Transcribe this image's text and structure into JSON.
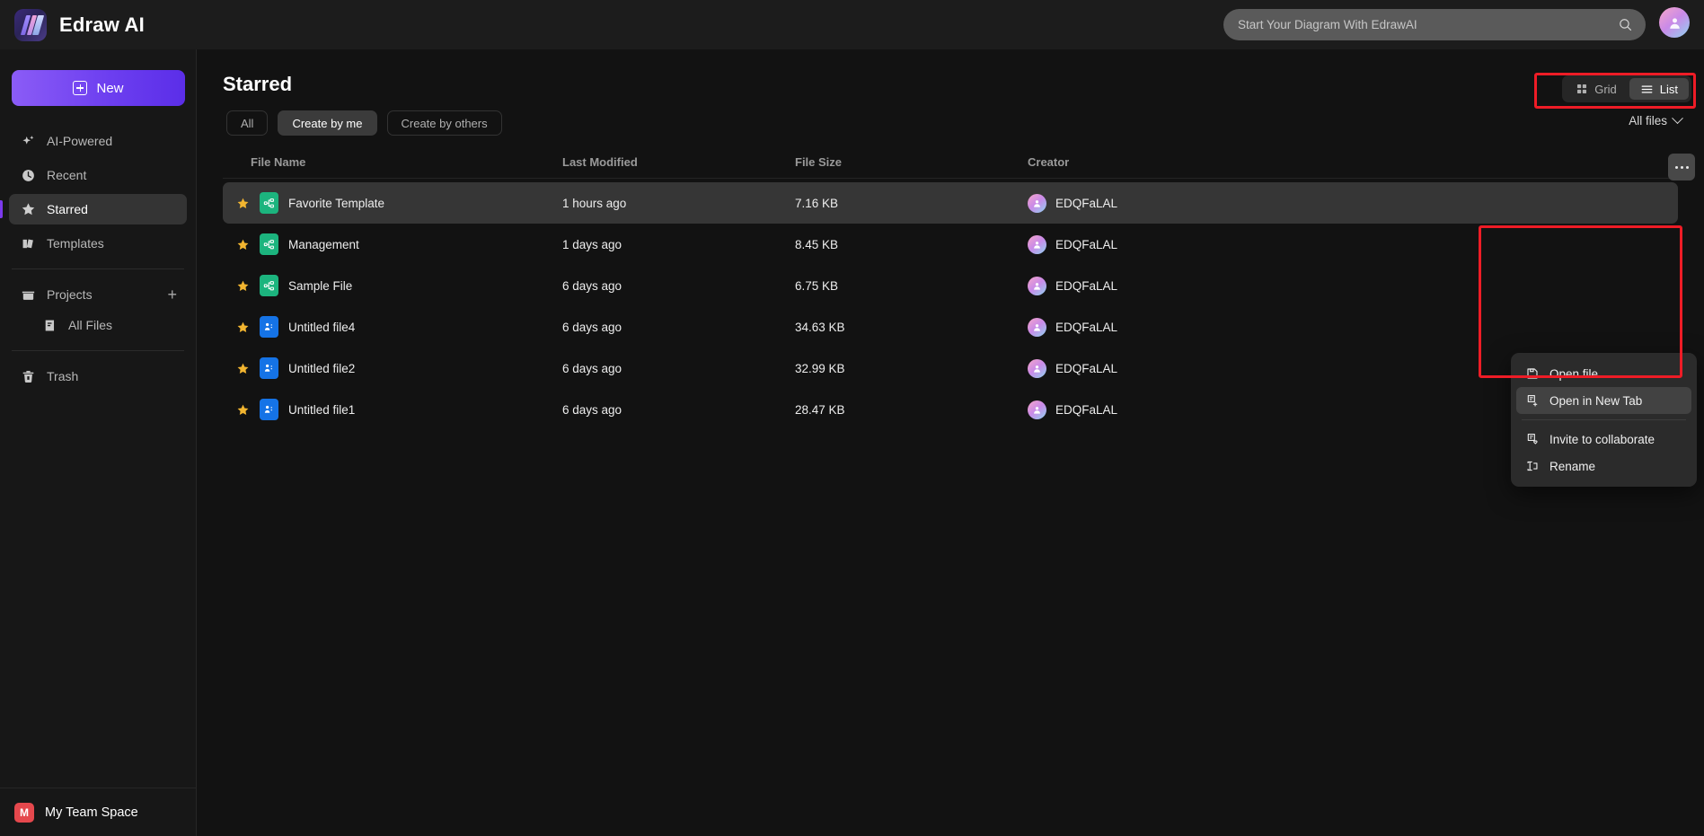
{
  "app": {
    "brand_name": "Edraw AI",
    "logo_icon": "edraw-logo-icon"
  },
  "search": {
    "placeholder": "Start Your Diagram With EdrawAI",
    "value": "",
    "icon": "search-icon"
  },
  "topbar": {
    "account_avatar": "user-avatar-icon"
  },
  "sidebar": {
    "new_button": {
      "label": "New",
      "icon": "plus-square-icon"
    },
    "items": [
      {
        "label": "AI-Powered",
        "icon": "sparkle-icon",
        "active": false
      },
      {
        "label": "Recent",
        "icon": "clock-icon",
        "active": false
      },
      {
        "label": "Starred",
        "icon": "star-icon",
        "active": true
      },
      {
        "label": "Templates",
        "icon": "templates-icon",
        "active": false
      }
    ],
    "projects": {
      "label": "Projects",
      "icon": "folder-icon",
      "add_icon": "plus-icon"
    },
    "project_children": [
      {
        "label": "All Files",
        "icon": "files-icon"
      }
    ],
    "trash": {
      "label": "Trash",
      "icon": "trash-icon"
    },
    "team_space": {
      "label": "My Team Space",
      "badge": "M",
      "badge_color": "#e5484d"
    }
  },
  "main": {
    "page_title": "Starred",
    "view_toggle": {
      "grid": {
        "label": "Grid",
        "icon": "grid-icon",
        "active": false
      },
      "list": {
        "label": "List",
        "icon": "list-icon",
        "active": true
      }
    },
    "filters": [
      {
        "label": "All",
        "active": false
      },
      {
        "label": "Create by me",
        "active": true
      },
      {
        "label": "Create by others",
        "active": false
      }
    ],
    "file_filter": {
      "label": "All files",
      "icon": "chevron-down-icon"
    },
    "columns": {
      "name": "File Name",
      "modified": "Last Modified",
      "size": "File Size",
      "creator": "Creator"
    },
    "rows": [
      {
        "name": "Favorite Template",
        "modified": "1 hours ago",
        "size": "7.16 KB",
        "creator": "EDQFaLAL",
        "icon": "diagram-file-icon",
        "icon_color": "#1cb47e",
        "starred": true,
        "selected": true
      },
      {
        "name": "Management",
        "modified": "1 days ago",
        "size": "8.45 KB",
        "creator": "EDQFaLAL",
        "icon": "diagram-file-icon",
        "icon_color": "#1cb47e",
        "starred": true,
        "selected": false
      },
      {
        "name": "Sample File",
        "modified": "6 days ago",
        "size": "6.75 KB",
        "creator": "EDQFaLAL",
        "icon": "diagram-file-icon",
        "icon_color": "#1cb47e",
        "starred": true,
        "selected": false
      },
      {
        "name": "Untitled file4",
        "modified": "6 days ago",
        "size": "34.63 KB",
        "creator": "EDQFaLAL",
        "icon": "org-chart-file-icon",
        "icon_color": "#1573e6",
        "starred": true,
        "selected": false
      },
      {
        "name": "Untitled file2",
        "modified": "6 days ago",
        "size": "32.99 KB",
        "creator": "EDQFaLAL",
        "icon": "org-chart-file-icon",
        "icon_color": "#1573e6",
        "starred": true,
        "selected": false
      },
      {
        "name": "Untitled file1",
        "modified": "6 days ago",
        "size": "28.47 KB",
        "creator": "EDQFaLAL",
        "icon": "org-chart-file-icon",
        "icon_color": "#1573e6",
        "starred": true,
        "selected": false
      }
    ]
  },
  "context_menu": {
    "items": [
      {
        "label": "Open file",
        "icon": "open-file-icon",
        "highlighted": false
      },
      {
        "label": "Open in New Tab",
        "icon": "new-tab-icon",
        "highlighted": true
      },
      {
        "label": "Invite to collaborate",
        "icon": "invite-icon",
        "highlighted": false
      },
      {
        "label": "Rename",
        "icon": "rename-icon",
        "highlighted": false
      }
    ],
    "separator_after_index": 1
  },
  "annotations": {
    "highlight_color": "#ee1c26",
    "boxes": [
      "view-toggle-highlight",
      "context-menu-highlight"
    ]
  },
  "colors": {
    "accent": "#7c3aed",
    "background": "#121212",
    "sidebar": "#171717",
    "topbar": "#1c1c1c",
    "row_selected": "#363636",
    "star": "#f2b530"
  }
}
